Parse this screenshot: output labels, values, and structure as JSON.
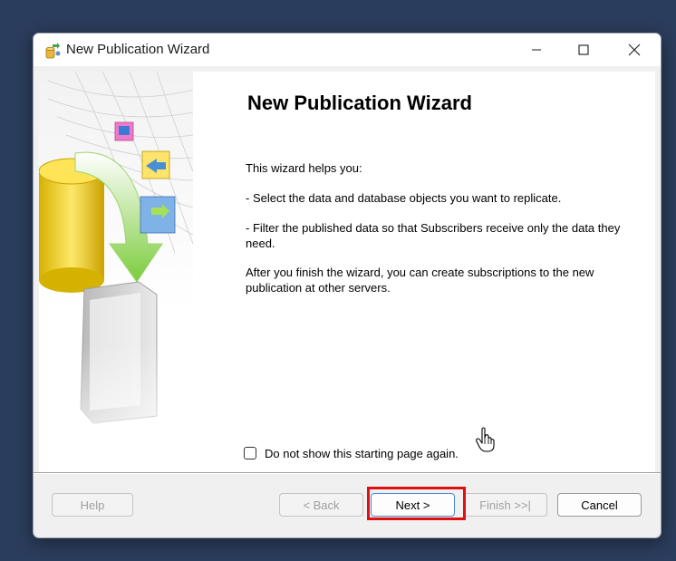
{
  "window": {
    "title": "New Publication Wizard"
  },
  "main": {
    "heading": "New Publication Wizard",
    "intro": "This wizard helps you:",
    "bullet1": " - Select the data and database objects you want to replicate.",
    "bullet2": " - Filter the published data so that Subscribers receive only the data they need.",
    "closing": " After you finish the wizard, you can create subscriptions to the new publication at other servers.",
    "checkbox_label": "Do not show this starting page again.",
    "checkbox_checked": false
  },
  "footer": {
    "help": "Help",
    "back": "< Back",
    "next": "Next >",
    "finish": "Finish >>|",
    "cancel": "Cancel"
  },
  "colors": {
    "desktop": "#2b3d5c",
    "highlight": "#e01010",
    "focus_border": "#4a86d8"
  },
  "icons": {
    "app": "wizard-app-icon",
    "minimize": "minimize-icon",
    "maximize": "maximize-icon",
    "close": "close-icon",
    "cursor": "hand-pointer-icon"
  }
}
